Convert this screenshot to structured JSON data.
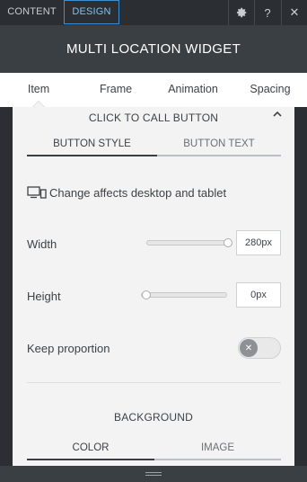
{
  "topbar": {
    "tab_content": "CONTENT",
    "tab_design": "DESIGN",
    "gear_icon": "gear-icon",
    "help_label": "?",
    "close_label": "✕"
  },
  "title": "MULTI LOCATION WIDGET",
  "nav": {
    "items": [
      {
        "label": "Item",
        "active": true
      },
      {
        "label": "Frame",
        "active": false
      },
      {
        "label": "Animation",
        "active": false
      },
      {
        "label": "Spacing",
        "active": false
      }
    ]
  },
  "section": {
    "title": "CLICK TO CALL BUTTON",
    "subtabs": {
      "button_style": "BUTTON STYLE",
      "button_text": "BUTTON TEXT"
    },
    "info_text": "Change affects desktop and tablet",
    "width": {
      "label": "Width",
      "value": "280px",
      "slider_fraction": 1.0
    },
    "height": {
      "label": "Height",
      "value": "0px",
      "slider_fraction": 0.0
    },
    "keep_proportion": {
      "label": "Keep proportion",
      "checked": false
    },
    "background": {
      "title": "BACKGROUND",
      "tab_color": "COLOR",
      "tab_image": "IMAGE"
    }
  },
  "colors": {
    "dark_bg": "#2b2f33",
    "title_bg": "#3a3f44",
    "accent_blue": "#3d8fd1",
    "panel_bg": "#f3f3f3"
  }
}
